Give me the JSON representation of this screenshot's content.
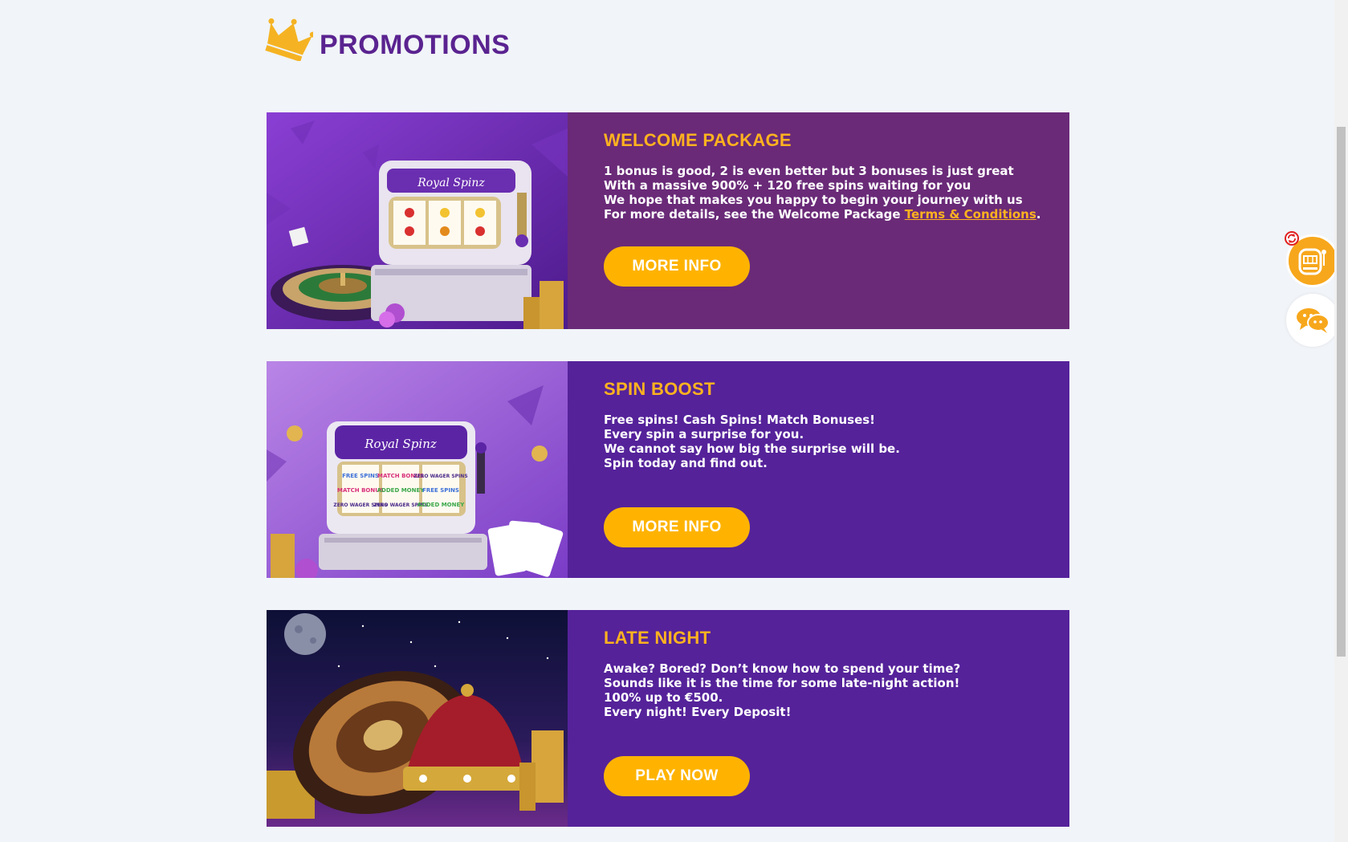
{
  "header": {
    "title": "PROMOTIONS",
    "logo_icon": "crown-icon"
  },
  "promotions": [
    {
      "title": "WELCOME PACKAGE",
      "image": "slot-machine-roulette-image",
      "lines": [
        "1 bonus is good, 2 is even better but 3 bonuses is just great",
        "With a massive 900% + 120 free spins waiting for you",
        "We hope that makes you happy to begin your journey with us"
      ],
      "details_prefix": "For more details, see the Welcome Package ",
      "details_link": "Terms & Conditions",
      "details_suffix": ".",
      "button": "MORE INFO"
    },
    {
      "title": "SPIN BOOST",
      "image": "spin-boost-slot-image",
      "lines": [
        "Free spins! Cash Spins! Match Bonuses!",
        "Every spin a surprise for you.",
        "We cannot say how big the surprise will be.",
        "Spin today and find out."
      ],
      "button": "MORE INFO"
    },
    {
      "title": "LATE NIGHT",
      "image": "roulette-crown-night-image",
      "lines": [
        "Awake? Bored? Don’t know how to spend your time?",
        "Sounds like it is the time for some late-night action!",
        "100% up to €500.",
        "Every night! Every Deposit!"
      ],
      "button": "PLAY NOW"
    }
  ],
  "slot_image_text": {
    "brand": "Royal Spinz",
    "reels": [
      "FREE SPINS",
      "MATCH BONUS",
      "ZERO WAGER SPINS",
      "MATCH BONUS",
      "ADDED MONEY",
      "FREE SPINS",
      "ZERO WAGER SPINS",
      "ZERO WAGER SPINS",
      "ADDED MONEY"
    ]
  },
  "widgets": {
    "slot_icon": "slot-machine-icon",
    "refresh_icon": "refresh-icon",
    "chat_icon": "chat-bubbles-icon"
  },
  "colors": {
    "accent": "#ffb21f",
    "title": "#5a2390",
    "card_1": "#6a2a78",
    "card_2": "#55229a"
  }
}
